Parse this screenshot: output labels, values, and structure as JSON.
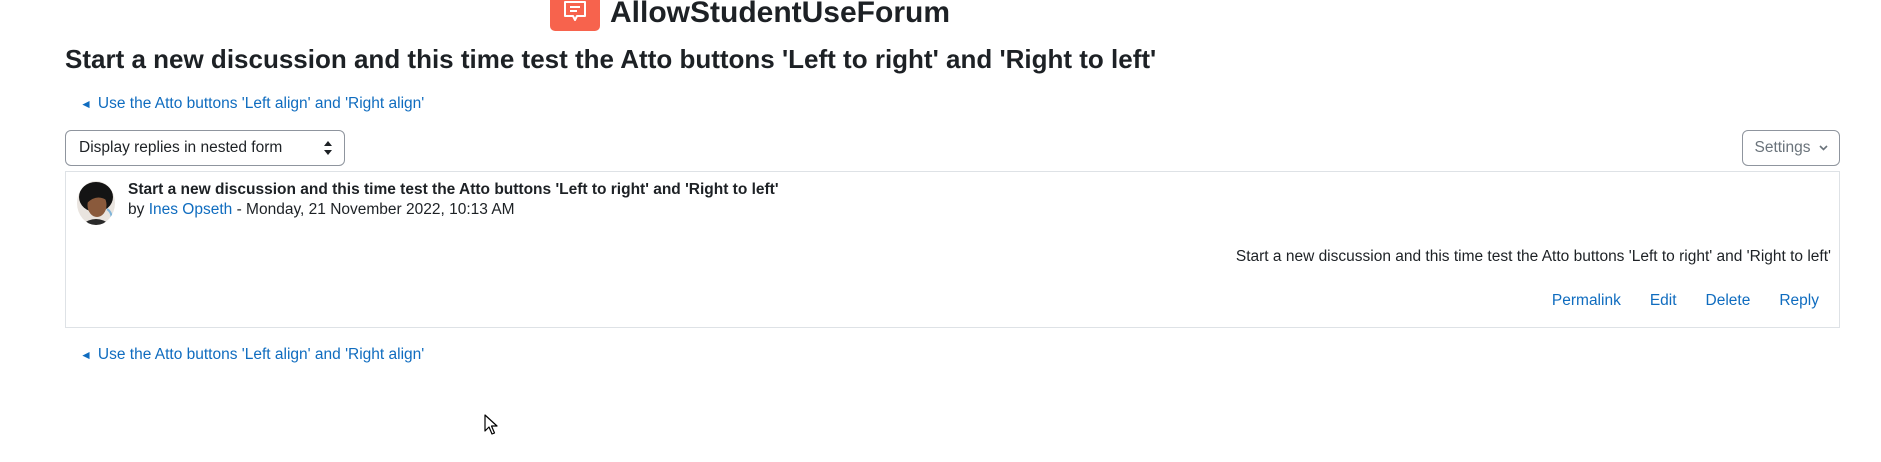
{
  "forum": {
    "name": "AllowStudentUseForum",
    "icon": "forum-icon",
    "icon_color": "#f7634d"
  },
  "discussion": {
    "title": "Start a new discussion and this time test the Atto buttons 'Left to right' and 'Right to left'"
  },
  "navigation": {
    "arrow": "◄",
    "previous_label": "Use the Atto buttons 'Left align' and 'Right align'"
  },
  "controls": {
    "display_mode": "Display replies in nested form",
    "settings_label": "Settings"
  },
  "post": {
    "subject": "Start a new discussion and this time test the Atto buttons 'Left to right' and 'Right to left'",
    "by_prefix": "by",
    "author": "Ines Opseth",
    "date_separator": " - ",
    "date": "Monday, 21 November 2022, 10:13 AM",
    "message": "Start a new discussion and this time test the Atto buttons 'Left to right' and 'Right to left'",
    "actions": {
      "permalink": "Permalink",
      "edit": "Edit",
      "delete": "Delete",
      "reply": "Reply"
    }
  },
  "colors": {
    "link": "#0f6cbf",
    "text": "#1d2125",
    "border": "#dee2e6"
  }
}
